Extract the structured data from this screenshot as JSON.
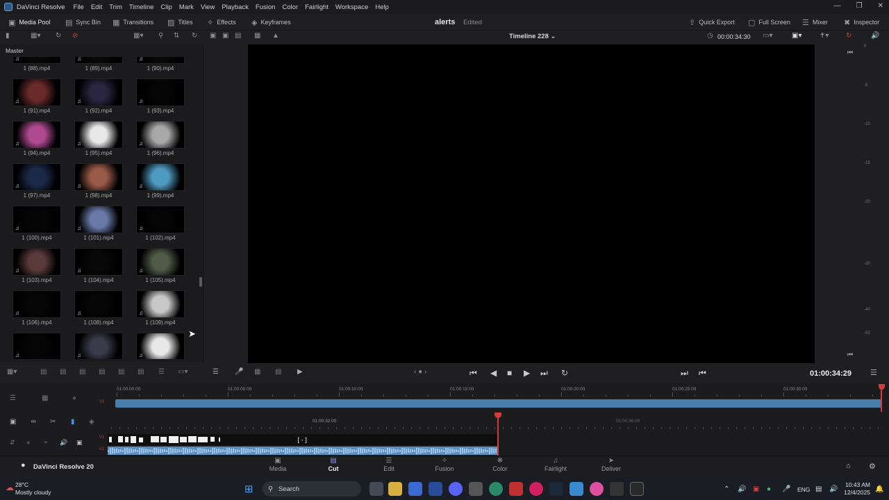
{
  "menubar": {
    "app_name": "DaVinci Resolve",
    "items": [
      "File",
      "Edit",
      "Trim",
      "Timeline",
      "Clip",
      "Mark",
      "View",
      "Playback",
      "Fusion",
      "Color",
      "Fairlight",
      "Workspace",
      "Help"
    ]
  },
  "toolbar": {
    "media_pool": "Media Pool",
    "sync_bin": "Sync Bin",
    "transitions": "Transitions",
    "titles": "Titles",
    "effects": "Effects",
    "keyframes": "Keyframes",
    "project_name": "alerts",
    "project_status": "Edited",
    "quick_export": "Quick Export",
    "full_screen": "Full Screen",
    "mixer": "Mixer",
    "inspector": "Inspector"
  },
  "viewer": {
    "timeline_name": "Timeline 228",
    "source_timecode": "00:00:34:30",
    "current_timecode": "01:00:34:29",
    "meter_ticks": [
      "0",
      "-5",
      "-10",
      "-15",
      "-20",
      "-30",
      "-40",
      "-50"
    ]
  },
  "media_pool": {
    "bin_title": "Master",
    "clips": [
      {
        "name": "1 (88).mp4",
        "thumb": "#0a0a0a"
      },
      {
        "name": "1 (89).mp4",
        "thumb": "#0a0a0a"
      },
      {
        "name": "1 (90).mp4",
        "thumb": "#0a0a0a"
      },
      {
        "name": "1 (91).mp4",
        "thumb": "#6a2a2a"
      },
      {
        "name": "1 (92).mp4",
        "thumb": "#2a2540"
      },
      {
        "name": "1 (93).mp4",
        "thumb": "#050505"
      },
      {
        "name": "1 (94).mp4",
        "thumb": "#b04a90"
      },
      {
        "name": "1 (95).mp4",
        "thumb": "#e8e8e8"
      },
      {
        "name": "1 (96).mp4",
        "thumb": "#a8a8a8"
      },
      {
        "name": "1 (97).mp4",
        "thumb": "#1c2a4a"
      },
      {
        "name": "1 (98).mp4",
        "thumb": "#9a5a48"
      },
      {
        "name": "1 (99).mp4",
        "thumb": "#4f9ac0"
      },
      {
        "name": "1 (100).mp4",
        "thumb": "#050505"
      },
      {
        "name": "1 (101).mp4",
        "thumb": "#6a7aa8"
      },
      {
        "name": "1 (102).mp4",
        "thumb": "#050505"
      },
      {
        "name": "1 (103).mp4",
        "thumb": "#5a3a3a"
      },
      {
        "name": "1 (104).mp4",
        "thumb": "#080808"
      },
      {
        "name": "1 (105).mp4",
        "thumb": "#4f5a48"
      },
      {
        "name": "1 (106).mp4",
        "thumb": "#060606"
      },
      {
        "name": "1 (108).mp4",
        "thumb": "#060606"
      },
      {
        "name": "1 (109).mp4",
        "thumb": "#c8c8c8"
      },
      {
        "name": "",
        "thumb": "#050505"
      },
      {
        "name": "",
        "thumb": "#3a3a4a"
      },
      {
        "name": "",
        "thumb": "#e8e8e8"
      }
    ]
  },
  "timeline": {
    "ruler_upper": [
      "01:00:00:00",
      "01:00:05:00",
      "01:00:10:00",
      "01:00:15:00",
      "01:00:20:00",
      "01:00:25:00",
      "01:00:30:00"
    ],
    "ruler_lower": [
      "01:00:32:00",
      "01:00:36:00"
    ],
    "track_v1": "V1",
    "track_a1": "A1",
    "track_v1_upper": "V1"
  },
  "pages": [
    {
      "label": "Media",
      "icon": "media-icon"
    },
    {
      "label": "Cut",
      "icon": "cut-icon",
      "active": true
    },
    {
      "label": "Edit",
      "icon": "edit-icon"
    },
    {
      "label": "Fusion",
      "icon": "fusion-icon"
    },
    {
      "label": "Color",
      "icon": "color-icon"
    },
    {
      "label": "Fairlight",
      "icon": "fairlight-icon"
    },
    {
      "label": "Deliver",
      "icon": "deliver-icon"
    }
  ],
  "brand": {
    "name": "DaVinci Resolve 20"
  },
  "taskbar": {
    "weather_temp": "28°C",
    "weather_desc": "Mostly cloudy",
    "search_label": "Search",
    "language": "ENG",
    "time": "10:43 AM",
    "date": "12/4/2025"
  },
  "colors": {
    "accent": "#8f8fe8",
    "playhead": "#d23b3b",
    "track": "#4a7eaa"
  }
}
